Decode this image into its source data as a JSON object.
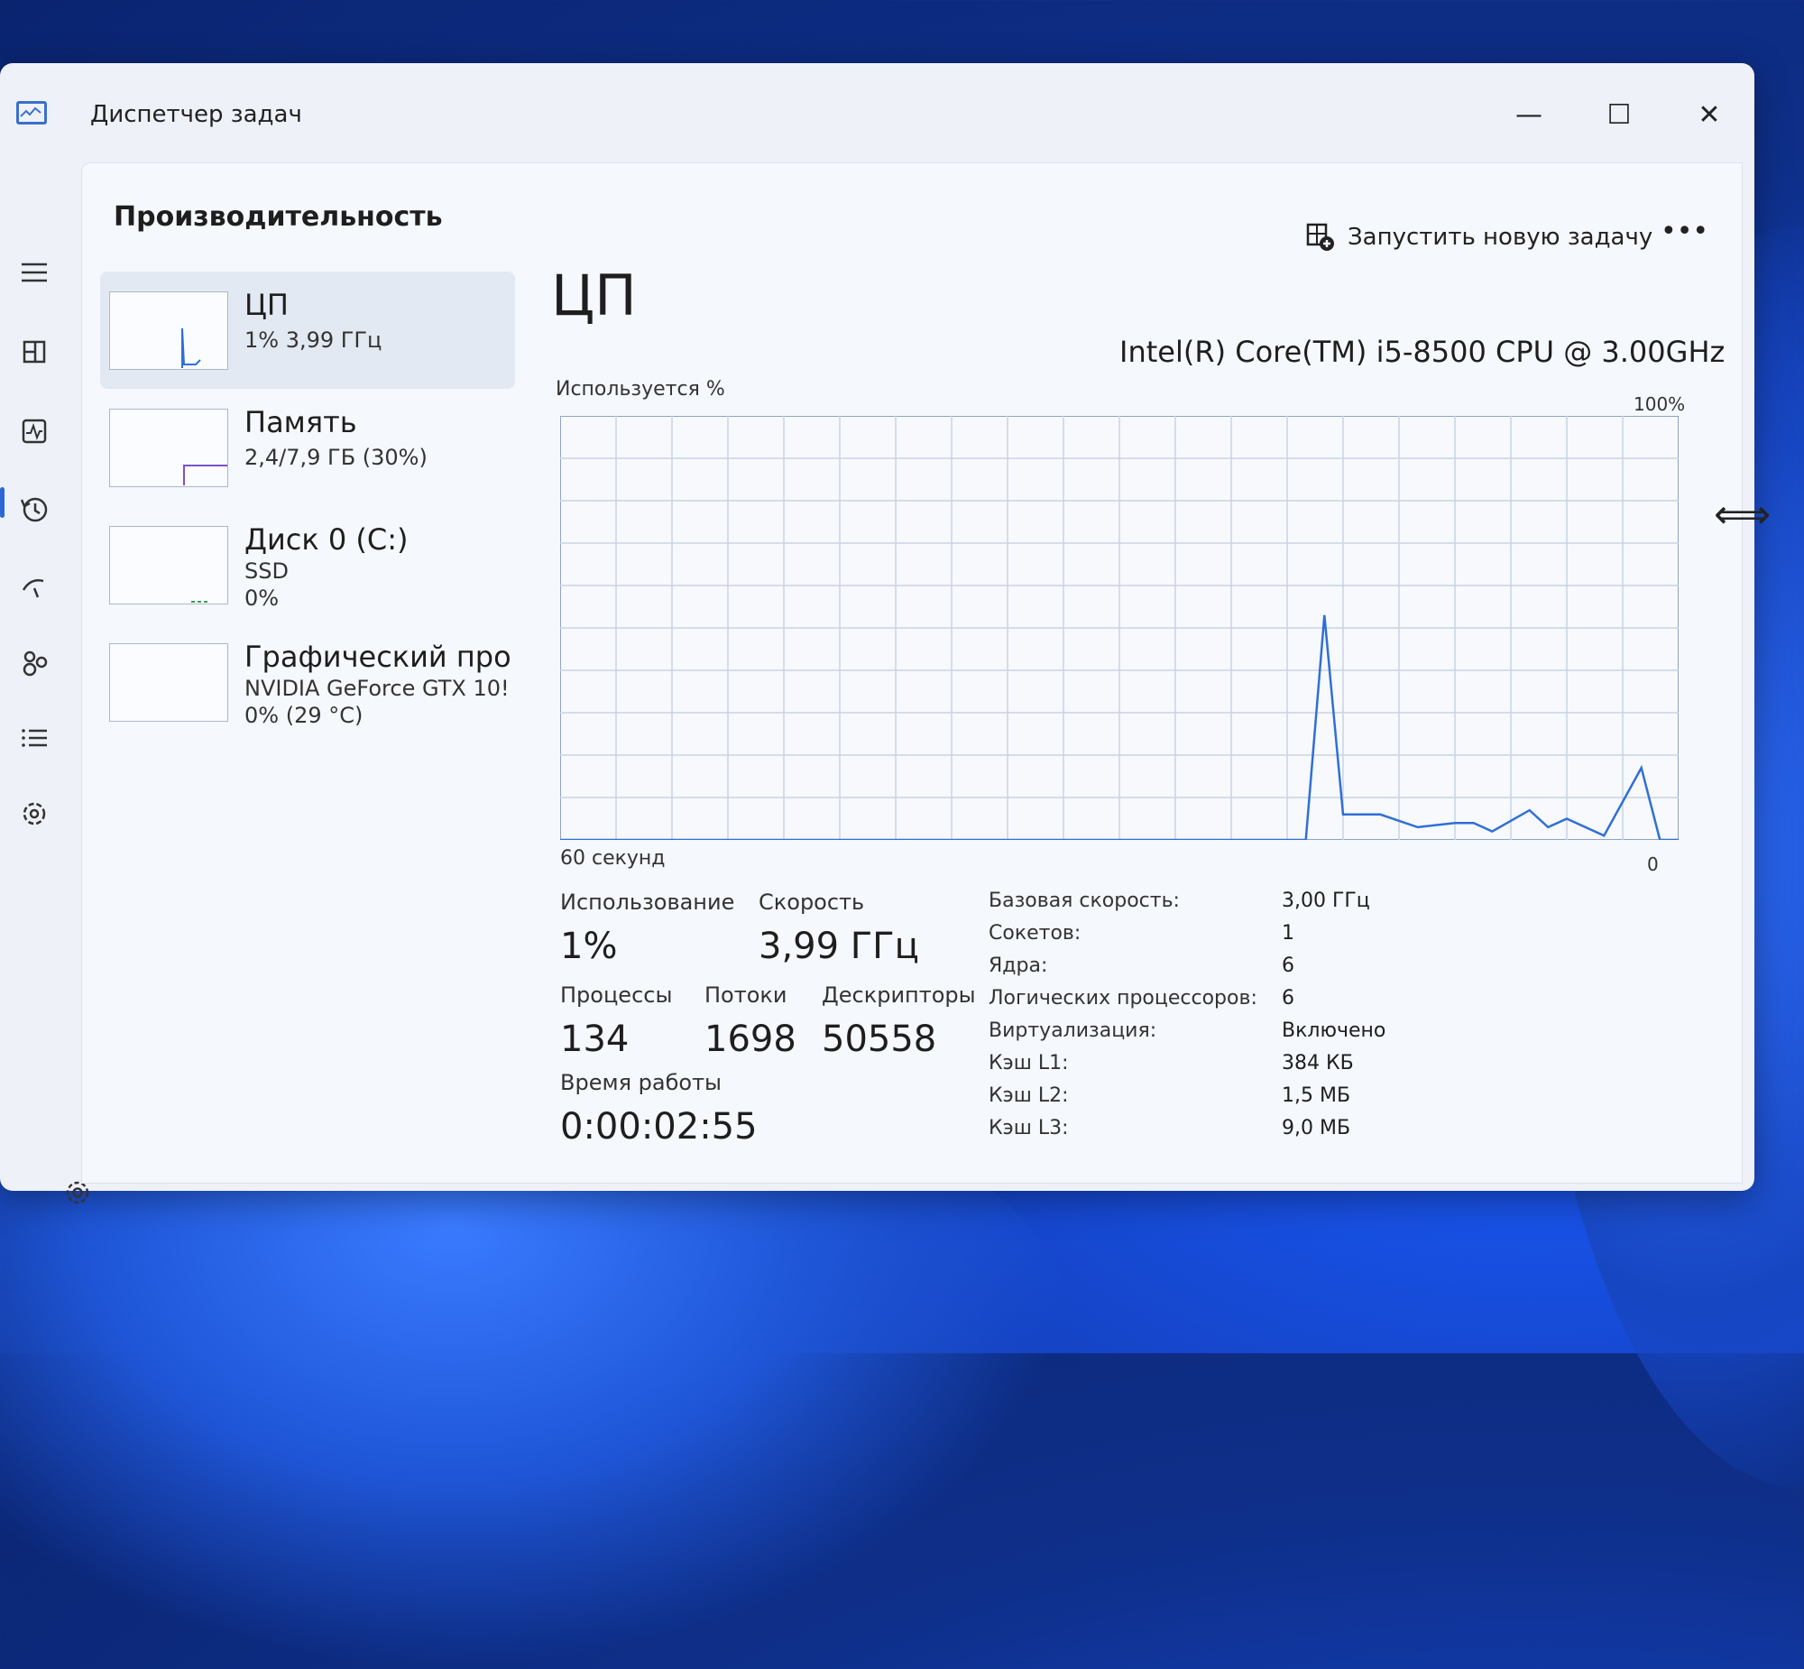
{
  "window": {
    "title": "Диспетчер задач"
  },
  "toolbar": {
    "page_title": "Производительность",
    "run_task_label": "Запустить новую задачу",
    "more_label": "•••"
  },
  "nav": {
    "icons": [
      "hamburger-menu-icon",
      "processes-icon",
      "performance-icon",
      "app-history-icon",
      "startup-apps-icon",
      "users-icon",
      "details-icon",
      "services-icon",
      "settings-icon"
    ],
    "active": "performance-icon"
  },
  "resources": [
    {
      "name": "ЦП",
      "sub": "1% 3,99 ГГц",
      "sub2": ""
    },
    {
      "name": "Память",
      "sub": "2,4/7,9 ГБ (30%)",
      "sub2": ""
    },
    {
      "name": "Диск 0 (C:)",
      "sub": "SSD",
      "sub2": "0%"
    },
    {
      "name": "Графический про",
      "sub": "NVIDIA GeForce GTX 10!",
      "sub2": "0% (29 °C)"
    }
  ],
  "main": {
    "title": "ЦП",
    "cpu_model": "Intel(R) Core(TM) i5-8500 CPU @ 3.00GHz",
    "graph_label": "Используется %",
    "graph_max": "100%",
    "graph_xlabel": "60 секунд",
    "graph_min": "0"
  },
  "stats": {
    "usage_label": "Использование",
    "usage_value": "1%",
    "speed_label": "Скорость",
    "speed_value": "3,99 ГГц",
    "processes_label": "Процессы",
    "processes_value": "134",
    "threads_label": "Потоки",
    "threads_value": "1698",
    "handles_label": "Дескрипторы",
    "handles_value": "50558",
    "uptime_label": "Время работы",
    "uptime_value": "0:00:02:55"
  },
  "specs": [
    {
      "key": "Базовая скорость:",
      "value": "3,00 ГГц"
    },
    {
      "key": "Сокетов:",
      "value": "1"
    },
    {
      "key": "Ядра:",
      "value": "6"
    },
    {
      "key": "Логических процессоров:",
      "value": "6"
    },
    {
      "key": "Виртуализация:",
      "value": "Включено"
    },
    {
      "key": "Кэш L1:",
      "value": "384 КБ"
    },
    {
      "key": "Кэш L2:",
      "value": "1,5 МБ"
    },
    {
      "key": "Кэш L3:",
      "value": "9,0 МБ"
    }
  ],
  "colors": {
    "accent": "#2b66d6",
    "graph_line": "#2f6fd6",
    "grid": "#c9d4e3"
  },
  "chart_data": {
    "type": "line",
    "x": [
      0,
      2,
      4,
      6,
      8,
      10,
      12,
      14,
      16,
      18,
      20,
      22,
      24,
      26,
      28,
      30,
      32,
      34,
      36,
      38,
      40,
      41,
      42,
      44,
      46,
      48,
      49,
      50,
      52,
      53,
      54,
      56,
      58,
      59,
      60
    ],
    "values": [
      0,
      0,
      0,
      0,
      0,
      0,
      0,
      0,
      0,
      0,
      0,
      0,
      0,
      0,
      0,
      0,
      0,
      0,
      0,
      0,
      0,
      53,
      6,
      6,
      3,
      4,
      4,
      2,
      7,
      3,
      5,
      1,
      17,
      0,
      0
    ],
    "xlim": [
      0,
      60
    ],
    "ylim": [
      0,
      100
    ]
  }
}
